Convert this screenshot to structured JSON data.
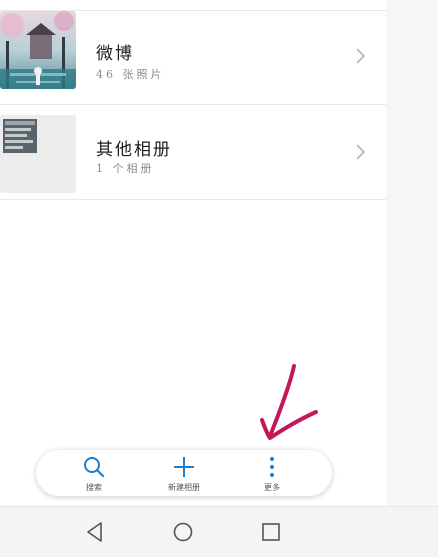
{
  "albums": [
    {
      "name": "微博",
      "count": "46 张照片"
    },
    {
      "name": "其他相册",
      "count": "1 个相册"
    }
  ],
  "action_bar": {
    "search_label": "搜索",
    "new_album_label": "新建相册",
    "more_label": "更多"
  },
  "colors": {
    "accent": "#1a7fd1",
    "annotation": "#c2185b",
    "divider": "#e8e8e8"
  },
  "icons": {
    "search": "search-icon",
    "add": "plus-icon",
    "more": "more-vertical-icon",
    "back": "back-triangle-icon",
    "home": "home-circle-icon",
    "recents": "recents-square-icon"
  }
}
